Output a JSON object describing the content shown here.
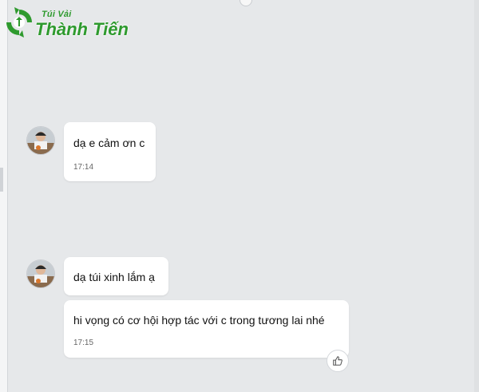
{
  "logo": {
    "small_text": "Túi Vải",
    "big_text": "Thành Tiến"
  },
  "messages": [
    {
      "text": "dạ e cảm ơn c",
      "time": "17:14"
    },
    {
      "text": "dạ túi xinh lắm ạ"
    },
    {
      "text": "hi vọng có cơ hội hợp tác với c trong tương lai nhé",
      "time": "17:15"
    }
  ],
  "icons": {
    "like": "thumbs-up-icon",
    "avatar": "avatar"
  },
  "colors": {
    "logo_green": "#2e9a2e",
    "background": "#e6e8ea",
    "bubble": "#ffffff"
  }
}
